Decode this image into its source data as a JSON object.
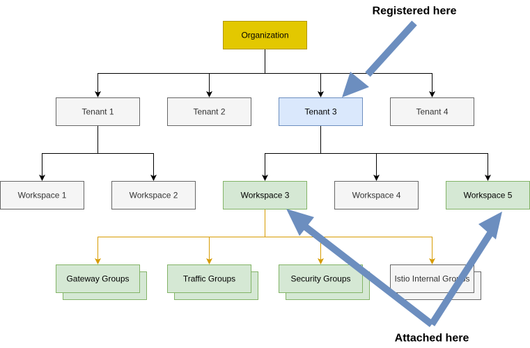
{
  "colors": {
    "organization_fill": "#e3c800",
    "organization_stroke": "#b09500",
    "default_fill": "#f5f5f5",
    "default_stroke": "#666666",
    "default_text": "#333333",
    "highlight_fill": "#dae8fc",
    "highlight_stroke": "#6c8ebf",
    "attached_fill": "#d5e8d4",
    "attached_stroke": "#82b366",
    "dark_text": "#000000",
    "edge_black": "#000000",
    "edge_group": "#d79b00",
    "callout_arrow": "#6c8ebf"
  },
  "nodes": {
    "organization": {
      "label": "Organization"
    },
    "tenant1": {
      "label": "Tenant 1"
    },
    "tenant2": {
      "label": "Tenant 2"
    },
    "tenant3": {
      "label": "Tenant 3"
    },
    "tenant4": {
      "label": "Tenant 4"
    },
    "workspace1": {
      "label": "Workspace 1"
    },
    "workspace2": {
      "label": "Workspace 2"
    },
    "workspace3": {
      "label": "Workspace 3"
    },
    "workspace4": {
      "label": "Workspace 4"
    },
    "workspace5": {
      "label": "Workspace 5"
    },
    "gateway_groups": {
      "label": "Gateway Groups"
    },
    "traffic_groups": {
      "label": "Traffic Groups"
    },
    "security_groups": {
      "label": "Security Groups"
    },
    "istio_internal_groups": {
      "label": "Istio Internal Groups"
    }
  },
  "callouts": {
    "registered": {
      "label": "Registered here"
    },
    "attached": {
      "label": "Attached here"
    }
  }
}
